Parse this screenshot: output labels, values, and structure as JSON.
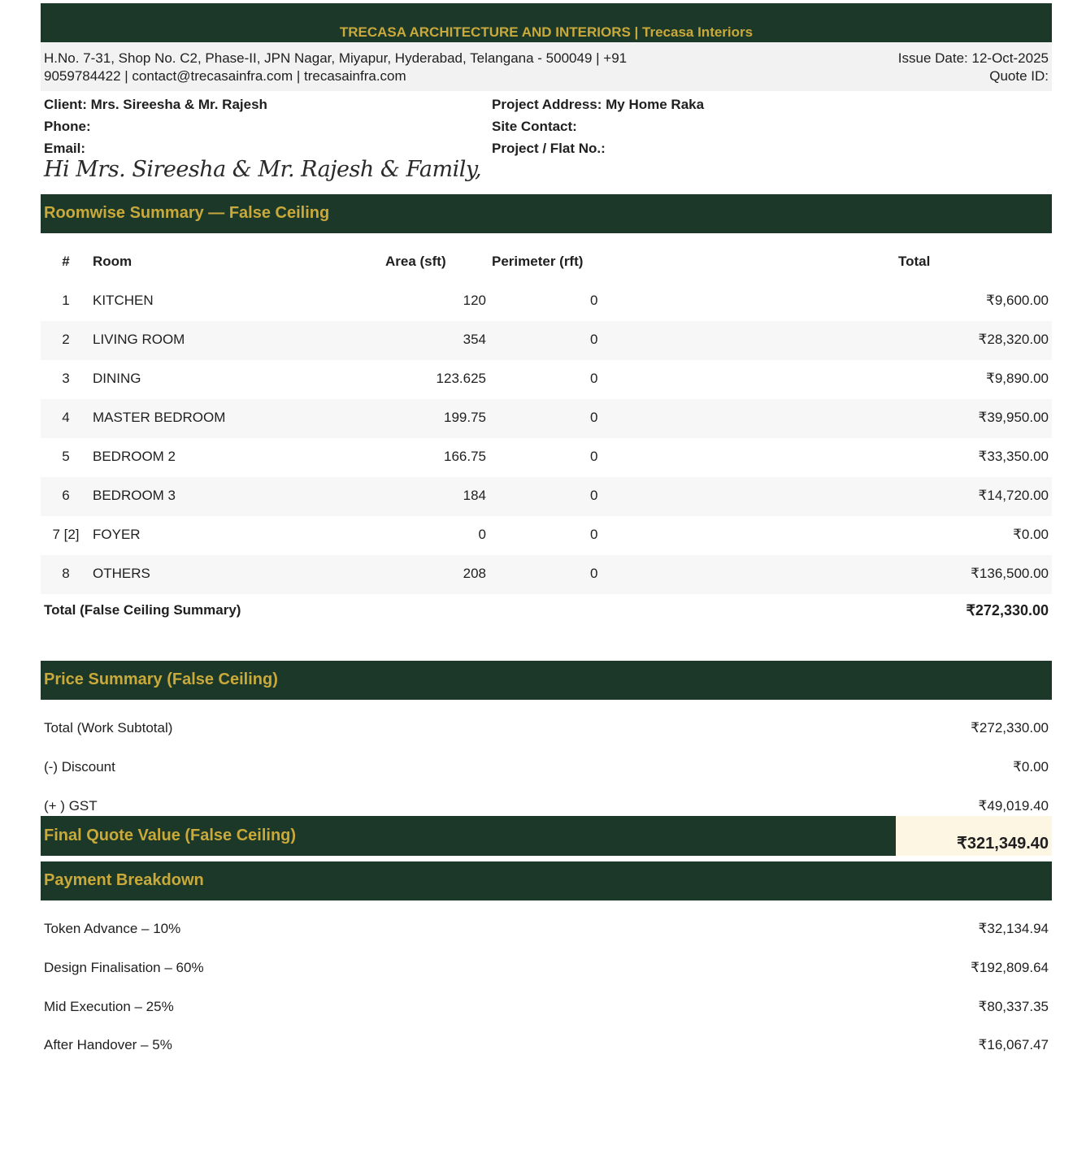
{
  "header": {
    "company": "TRECASA ARCHITECTURE AND INTERIORS | Trecasa Interiors",
    "address_line1": "H.No. 7-31, Shop No. C2, Phase-II, JPN Nagar, Miyapur, Hyderabad, Telangana - 500049 | +91",
    "address_line2": "9059784422 | contact@trecasainfra.com | trecasainfra.com",
    "issue_date": "Issue Date: 12-Oct-2025",
    "quote_id": "Quote ID:"
  },
  "client": {
    "name": "Client: Mrs. Sireesha & Mr. Rajesh",
    "phone": "Phone:",
    "email": "Email:",
    "project_address": "Project Address: My Home Raka",
    "site_contact": "Site Contact:",
    "flat_no": "Project / Flat No.:"
  },
  "greeting": "Hi Mrs. Sireesha & Mr. Rajesh & Family,",
  "roomwise": {
    "title": "Roomwise Summary — False Ceiling",
    "headers": {
      "num": "#",
      "room": "Room",
      "area": "Area (sft)",
      "perimeter": "Perimeter (rft)",
      "total": "Total"
    },
    "rows": [
      {
        "num": "1",
        "room": "KITCHEN",
        "area": "120",
        "perimeter": "0",
        "total": "₹9,600.00"
      },
      {
        "num": "2",
        "room": "LIVING ROOM",
        "area": "354",
        "perimeter": "0",
        "total": "₹28,320.00"
      },
      {
        "num": "3",
        "room": "DINING",
        "area": "123.625",
        "perimeter": "0",
        "total": "₹9,890.00"
      },
      {
        "num": "4",
        "room": "MASTER BEDROOM",
        "area": "199.75",
        "perimeter": "0",
        "total": "₹39,950.00"
      },
      {
        "num": "5",
        "room": "BEDROOM 2",
        "area": "166.75",
        "perimeter": "0",
        "total": "₹33,350.00"
      },
      {
        "num": "6",
        "room": "BEDROOM 3",
        "area": "184",
        "perimeter": "0",
        "total": "₹14,720.00"
      },
      {
        "num": "7 [2]",
        "room": "FOYER",
        "area": "0",
        "perimeter": "0",
        "total": "₹0.00"
      },
      {
        "num": "8",
        "room": "OTHERS",
        "area": "208",
        "perimeter": "0",
        "total": "₹136,500.00"
      }
    ],
    "total_label": "Total (False Ceiling Summary)",
    "total_value": "₹272,330.00"
  },
  "price_summary": {
    "title": "Price Summary (False Ceiling)",
    "subtotal_label": "Total (Work Subtotal)",
    "subtotal_value": "₹272,330.00",
    "discount_label": "(-) Discount",
    "discount_value": "₹0.00",
    "gst_label": "(+ ) GST",
    "gst_value": "₹49,019.40",
    "final_label": "Final Quote Value (False Ceiling)",
    "final_value": "₹321,349.40"
  },
  "payment": {
    "title": "Payment Breakdown",
    "items": [
      {
        "label": "Token Advance – 10%",
        "value": "₹32,134.94"
      },
      {
        "label": "Design Finalisation – 60%",
        "value": "₹192,809.64"
      },
      {
        "label": "Mid Execution – 25%",
        "value": "₹80,337.35"
      },
      {
        "label": "After Handover – 5%",
        "value": "₹16,067.47"
      }
    ]
  },
  "colors": {
    "banner_bg": "#1c3829",
    "banner_text": "#c9a93a",
    "final_value_bg": "#fdf6e3"
  }
}
